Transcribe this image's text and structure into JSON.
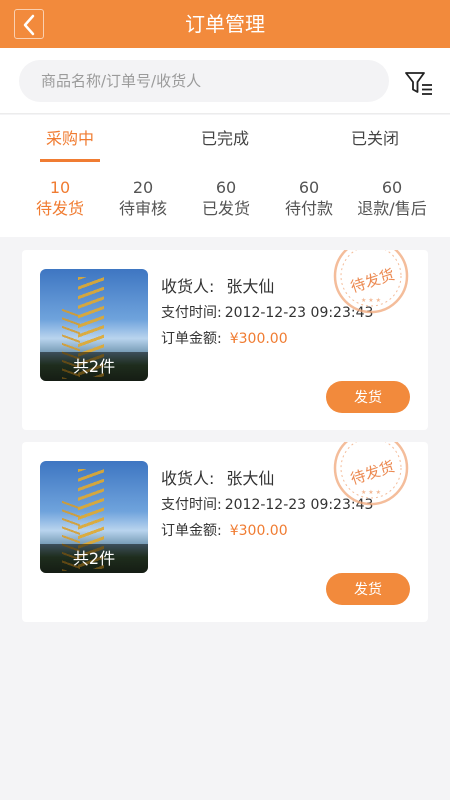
{
  "header": {
    "title": "订单管理",
    "back_icon": "chevron-left-icon"
  },
  "search": {
    "placeholder": "商品名称/订单号/收货人",
    "value": "",
    "filter_icon": "filter-icon"
  },
  "tabs": [
    {
      "label": "采购中",
      "active": true
    },
    {
      "label": "已完成",
      "active": false
    },
    {
      "label": "已关闭",
      "active": false
    }
  ],
  "subtabs": [
    {
      "count": "10",
      "label": "待发货",
      "active": true
    },
    {
      "count": "20",
      "label": "待审核",
      "active": false
    },
    {
      "count": "60",
      "label": "已发货",
      "active": false
    },
    {
      "count": "60",
      "label": "待付款",
      "active": false
    },
    {
      "count": "60",
      "label": "退款/售后",
      "active": false
    }
  ],
  "orders": [
    {
      "image_caption": "共2件",
      "receiver_label": "收货人:",
      "receiver": "张大仙",
      "pay_time_label": "支付时间:",
      "pay_time": "2012-12-23 09:23:43",
      "amount_label": "订单金额:",
      "amount": "¥300.00",
      "stamp_text": "待发货",
      "action_label": "发货"
    },
    {
      "image_caption": "共2件",
      "receiver_label": "收货人:",
      "receiver": "张大仙",
      "pay_time_label": "支付时间:",
      "pay_time": "2012-12-23 09:23:43",
      "amount_label": "订单金额:",
      "amount": "¥300.00",
      "stamp_text": "待发货",
      "action_label": "发货"
    }
  ],
  "colors": {
    "accent": "#f28a3c",
    "accent_text": "#f07c32",
    "background": "#f4f4f6"
  }
}
